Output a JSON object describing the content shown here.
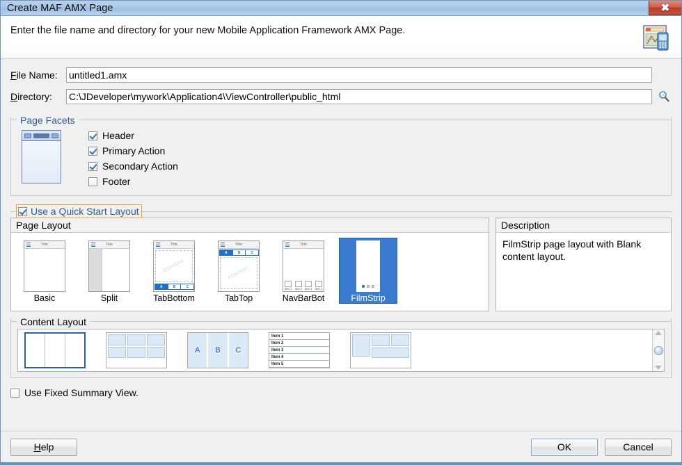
{
  "window": {
    "title": "Create MAF AMX Page",
    "close_icon": "close-icon",
    "close_label": "✖"
  },
  "header": {
    "instruction": "Enter the file name and directory for your new Mobile Application Framework AMX Page.",
    "icon": "maf-amx-page-icon"
  },
  "form": {
    "file_name": {
      "label_prefix": "F",
      "label_rest": "ile Name:",
      "value": "untitled1.amx"
    },
    "directory": {
      "label_prefix": "D",
      "label_rest": "irectory:",
      "value": "C:\\JDeveloper\\mywork\\Application4\\ViewController\\public_html",
      "browse_icon": "magnifier-browse-icon"
    }
  },
  "page_facets": {
    "title": "Page Facets",
    "items": [
      {
        "label": "Header",
        "checked": true
      },
      {
        "label": "Primary Action",
        "checked": true
      },
      {
        "label": "Secondary Action",
        "checked": true
      },
      {
        "label": "Footer",
        "checked": false
      }
    ]
  },
  "quick_start": {
    "label": "Use a Quick Start Layout",
    "checked": true,
    "focus_color": "#e8a33d"
  },
  "page_layout": {
    "pane_title": "Page Layout",
    "selected": "FilmStrip",
    "items": [
      {
        "name": "Basic",
        "kind": "basic"
      },
      {
        "name": "Split",
        "kind": "split"
      },
      {
        "name": "TabBottom",
        "kind": "tab-bottom"
      },
      {
        "name": "TabTop",
        "kind": "tab-top"
      },
      {
        "name": "NavBarBot",
        "kind": "navbar-bottom"
      },
      {
        "name": "FilmStrip",
        "kind": "filmstrip"
      }
    ],
    "thumb_title": "Title",
    "thumb_content_word": "CONTENT",
    "tab_labels": [
      "A",
      "B",
      "C"
    ],
    "navbar_labels": [
      "Item 1",
      "Item 2",
      "Item 3",
      "Item 4"
    ]
  },
  "description": {
    "pane_title": "Description",
    "text": "FilmStrip page layout with Blank content layout."
  },
  "content_layout": {
    "title": "Content Layout",
    "selected_index": 0,
    "items": [
      {
        "kind": "blank"
      },
      {
        "kind": "grid"
      },
      {
        "kind": "abc"
      },
      {
        "kind": "list"
      },
      {
        "kind": "panel"
      }
    ],
    "abc_labels": [
      "A",
      "B",
      "C"
    ],
    "list_items": [
      "Item 1",
      "Item 2",
      "Item 3",
      "Item 4",
      "Item 5"
    ],
    "scroll_up_icon": "scroll-up-arrow-icon",
    "scroll_down_icon": "scroll-down-arrow-icon"
  },
  "fixed_summary": {
    "label": "Use Fixed Summary View.",
    "checked": false
  },
  "footer": {
    "help_prefix": "H",
    "help_rest": "elp",
    "ok": "OK",
    "cancel": "Cancel"
  },
  "colors": {
    "accent": "#3a7bd0",
    "title_blue": "#2c5d8f",
    "focus_orange": "#e8a33d",
    "close_red": "#bc3b25"
  }
}
